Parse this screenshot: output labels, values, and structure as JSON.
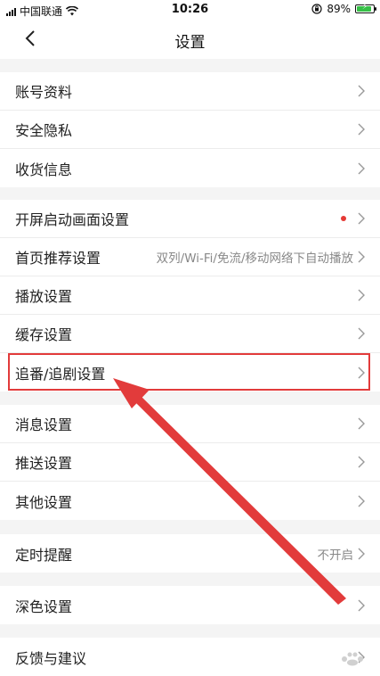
{
  "status": {
    "carrier": "中国联通",
    "time": "10:26",
    "battery": "89%",
    "battery_level": 0.89,
    "battery_color": "#35c046"
  },
  "nav": {
    "title": "设置",
    "back_icon": "chevron-left-icon"
  },
  "sections": [
    {
      "items": [
        {
          "label": "账号资料"
        },
        {
          "label": "安全隐私"
        },
        {
          "label": "收货信息"
        }
      ]
    },
    {
      "items": [
        {
          "label": "开屏启动画面设置",
          "badge": "red-dot"
        },
        {
          "label": "首页推荐设置",
          "value": "双列/Wi-Fi/免流/移动网络下自动播放"
        },
        {
          "label": "播放设置"
        },
        {
          "label": "缓存设置"
        },
        {
          "label": "追番/追剧设置",
          "highlighted": true
        }
      ]
    },
    {
      "items": [
        {
          "label": "消息设置"
        },
        {
          "label": "推送设置"
        },
        {
          "label": "其他设置"
        }
      ]
    },
    {
      "items": [
        {
          "label": "定时提醒",
          "value": "不开启"
        }
      ]
    },
    {
      "items": [
        {
          "label": "深色设置"
        }
      ]
    },
    {
      "items": [
        {
          "label": "反馈与建议"
        }
      ]
    }
  ],
  "annotation": {
    "color": "#e23b3b"
  }
}
